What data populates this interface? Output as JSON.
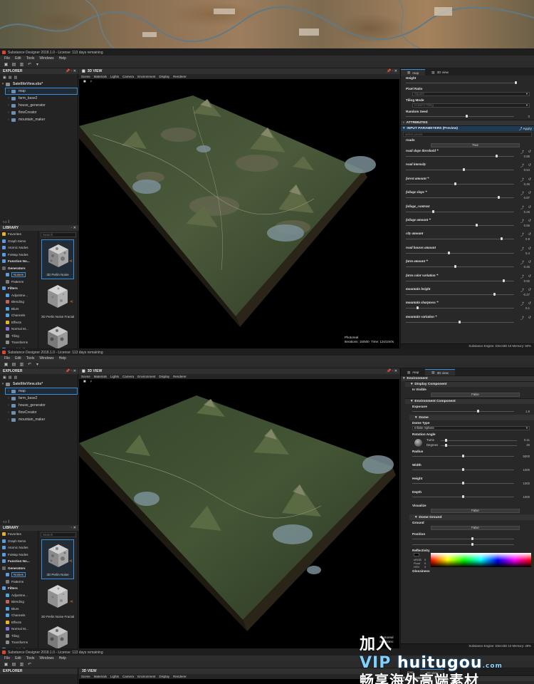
{
  "app": {
    "title": "Substance Designer 2018.1.0 - License: 113 days remaining",
    "menu": [
      "File",
      "Edit",
      "Tools",
      "Windows",
      "Help"
    ]
  },
  "explorer": {
    "title": "EXPLORER",
    "package": "SatelliteView.sbs*",
    "items": [
      "map",
      "farm_base2",
      "house_generator",
      "flowCreator",
      "mountain_maker"
    ]
  },
  "library": {
    "title": "LIBRARY",
    "search_placeholder": "Search",
    "tree": [
      {
        "label": "Favorites",
        "kind": "item",
        "color": "#e6b422"
      },
      {
        "label": "Graph Items",
        "kind": "item",
        "color": "#5a9be0"
      },
      {
        "label": "Atomic Nodes",
        "kind": "item",
        "color": "#5a9be0"
      },
      {
        "label": "FxMap Nodes",
        "kind": "item",
        "color": "#5a9be0"
      },
      {
        "label": "Function No...",
        "kind": "head",
        "color": "#5a9be0"
      },
      {
        "label": "Generators",
        "kind": "head",
        "color": "#6a6a6a"
      },
      {
        "label": "Noises",
        "kind": "sub",
        "color": "#5a9be0"
      },
      {
        "label": "Patterns",
        "kind": "sub",
        "color": "#7a7a7a"
      },
      {
        "label": "Filters",
        "kind": "head",
        "color": "#5a9be0"
      },
      {
        "label": "Adjustme...",
        "kind": "sub",
        "color": "#4fa3e0"
      },
      {
        "label": "Blending",
        "kind": "sub",
        "color": "#c95e5e"
      },
      {
        "label": "Blurs",
        "kind": "sub",
        "color": "#4fa3e0"
      },
      {
        "label": "Channels",
        "kind": "sub",
        "color": "#4fa3e0"
      },
      {
        "label": "Effects",
        "kind": "sub",
        "color": "#e6b422"
      },
      {
        "label": "Normal M...",
        "kind": "sub",
        "color": "#8a6fd6"
      },
      {
        "label": "Tiling",
        "kind": "sub",
        "color": "#8a8a8a"
      },
      {
        "label": "Transforms",
        "kind": "sub",
        "color": "#8a8a8a"
      },
      {
        "label": "Material Filters",
        "kind": "head",
        "color": "#5a9be0"
      }
    ],
    "thumbs": [
      "3D Perlin Noise",
      "3D Perlin Noise Fractal",
      ""
    ]
  },
  "view3d": {
    "title": "3D VIEW",
    "menu": [
      "Scene",
      "Materials",
      "Lights",
      "Camera",
      "Environment",
      "Display",
      "Renderer"
    ],
    "info1": [
      "Photoreal",
      "Iterations: 15/500",
      "Time: 12s/1m0s"
    ],
    "info2": [
      "Photoreal",
      "Iterations:"
    ]
  },
  "right1": {
    "tabs": [
      "map",
      "3D view"
    ],
    "top_props": [
      {
        "label": "Height",
        "knob": 0.95,
        "val": ""
      },
      {
        "label": "Pixel Ratio",
        "dropdown": "Square",
        "dimmed": true
      },
      {
        "label": "Tiling Mode",
        "dropdown": "H and V Tiling",
        "dimmed": true
      },
      {
        "label": "Random Seed",
        "knob": 0.05,
        "val": "0"
      }
    ],
    "sections": [
      "ATTRIBUTES",
      "INPUT PARAMETERS (Preview)"
    ],
    "apply": "Apply",
    "preset": "select preset",
    "roads_label": "roads",
    "roads_value": "True",
    "params": [
      {
        "label": "road slope threshold *",
        "val": "0.85",
        "pos": 0.85
      },
      {
        "label": "road intensity",
        "val": "0.54",
        "pos": 0.54
      },
      {
        "label": "forest amount *",
        "val": "0.46",
        "pos": 0.46
      },
      {
        "label": "foliage slope *",
        "val": "0.87",
        "pos": 0.87
      },
      {
        "label": "foliage_contrast",
        "val": "0.25",
        "pos": 0.25
      },
      {
        "label": "foliage amount *",
        "val": "0.66",
        "pos": 0.66
      },
      {
        "label": "city amount",
        "val": "0.9",
        "pos": 0.9
      },
      {
        "label": "road houses amount",
        "val": "0.4",
        "pos": 0.4
      },
      {
        "label": "farm amount *",
        "val": "0.46",
        "pos": 0.46
      },
      {
        "label": "farm color variation *",
        "val": "0.92",
        "pos": 0.92
      },
      {
        "label": "mountain height",
        "val": "-0.27",
        "pos": 0.83
      },
      {
        "label": "mountain sharpness *",
        "val": "0.1",
        "pos": 0.1
      },
      {
        "label": "mountain variation *",
        "val": "",
        "pos": 0.5
      }
    ],
    "status": "Substance Engine: Direct3D 10   Memory: 50%"
  },
  "right2": {
    "tabs": [
      "map",
      "3D view"
    ],
    "environment": "Environment",
    "display_component": "Display Component",
    "is_visible": "Is Visible",
    "false_label": "False",
    "env_component": "Environment Component",
    "exposure": {
      "label": "Exposure",
      "val": "1.9",
      "pos": 0.55
    },
    "dome": "Dome",
    "dome_type_label": "Dome Type",
    "dome_type": "Infinite Sphere",
    "rotation_angle": "Rotation Angle",
    "turns": {
      "label": "Turns",
      "val": "0.11",
      "pos": 0.11
    },
    "degrees": {
      "label": "Degrees",
      "val": "40",
      "pos": 0.11
    },
    "dims": [
      {
        "label": "Radius",
        "val": "5000",
        "pos": 0.5
      },
      {
        "label": "Width",
        "val": "1000",
        "pos": 0.5
      },
      {
        "label": "Height",
        "val": "1000",
        "pos": 0.5
      },
      {
        "label": "Depth",
        "val": "1000",
        "pos": 0.5
      }
    ],
    "visualize": "Visualize",
    "dome_ground": "Dome Ground",
    "ground": "Ground",
    "position": "Position",
    "reflectivity": "Reflectivity",
    "channels": [
      {
        "label": "sRGB",
        "val": "0"
      },
      {
        "label": "Float",
        "val": "0"
      },
      {
        "label": "HSV",
        "val": "0"
      }
    ],
    "glossiness": "Glossiness",
    "status": "Substance Engine: Direct3D 10   Memory: 48%"
  },
  "watermark": {
    "line1_prefix": "加入",
    "line1_vip": "VIP",
    "brand": "huitugou",
    "brand_com": ".com",
    "line2": "畅享海外高端素材"
  }
}
